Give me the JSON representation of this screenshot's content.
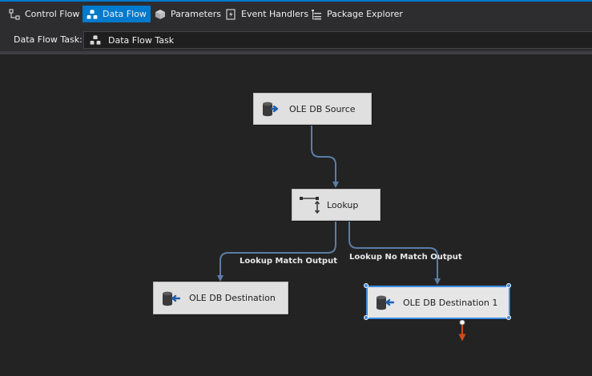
{
  "tabs": [
    {
      "label": "Control Flow",
      "icon": "control-flow-icon",
      "active": false
    },
    {
      "label": "Data Flow",
      "icon": "data-flow-icon",
      "active": true
    },
    {
      "label": "Parameters",
      "icon": "parameters-icon",
      "active": false
    },
    {
      "label": "Event Handlers",
      "icon": "event-handlers-icon",
      "active": false
    },
    {
      "label": "Package Explorer",
      "icon": "package-explorer-icon",
      "active": false
    }
  ],
  "task": {
    "label": "Data Flow Task:",
    "selected": "Data Flow Task"
  },
  "nodes": {
    "source": {
      "label": "OLE DB Source"
    },
    "lookup": {
      "label": "Lookup"
    },
    "dest": {
      "label": "OLE DB Destination"
    },
    "dest1": {
      "label": "OLE DB Destination 1"
    }
  },
  "paths": {
    "match": "Lookup Match Output",
    "nomatch": "Lookup No Match Output"
  },
  "colors": {
    "accent": "#007acc",
    "connector": "#5b7da5",
    "error_path": "#d24a1a",
    "selection": "#3f8ae0"
  }
}
